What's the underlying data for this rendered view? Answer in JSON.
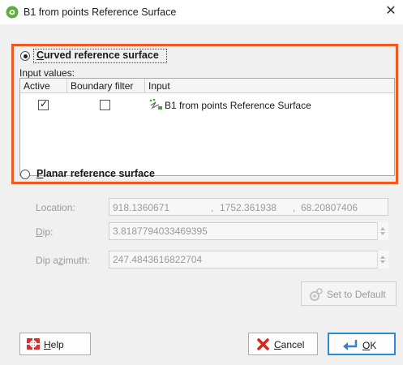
{
  "window": {
    "title": "B1 from points Reference Surface",
    "close_glyph": "✕"
  },
  "curved": {
    "label_hotkey": "C",
    "label_rest": "urved reference surface",
    "selected": true,
    "input_values_label": "Input values:",
    "table": {
      "headers": [
        "Active",
        "Boundary filter",
        "Input"
      ],
      "rows": [
        {
          "active": true,
          "boundary_filter": false,
          "icon": "surface-points-icon",
          "input": "B1 from points Reference Surface"
        }
      ]
    }
  },
  "planar": {
    "label_hotkey": "P",
    "label_rest": "lanar reference surface",
    "selected": false,
    "location": {
      "label": "Location:",
      "x": "918.1360671",
      "y": "1752.361938",
      "z": "68.20807406",
      "separator": ","
    },
    "dip": {
      "label_hotkey": "D",
      "label_rest": "ip:",
      "value": "3.8187794033469395"
    },
    "dip_azimuth": {
      "label_pre": "Dip a",
      "label_hotkey": "z",
      "label_post": "imuth:",
      "value": "247.4843616822704"
    },
    "set_default_label": "Set to Default"
  },
  "footer": {
    "help_hotkey": "H",
    "help_rest": "elp",
    "cancel_hotkey": "C",
    "cancel_rest": "ancel",
    "ok_hotkey": "O",
    "ok_rest": "K"
  },
  "colors": {
    "highlight": "#f05a1e",
    "default_button_border": "#2a8bd6",
    "dialog_bg": "#f0f0f0"
  }
}
